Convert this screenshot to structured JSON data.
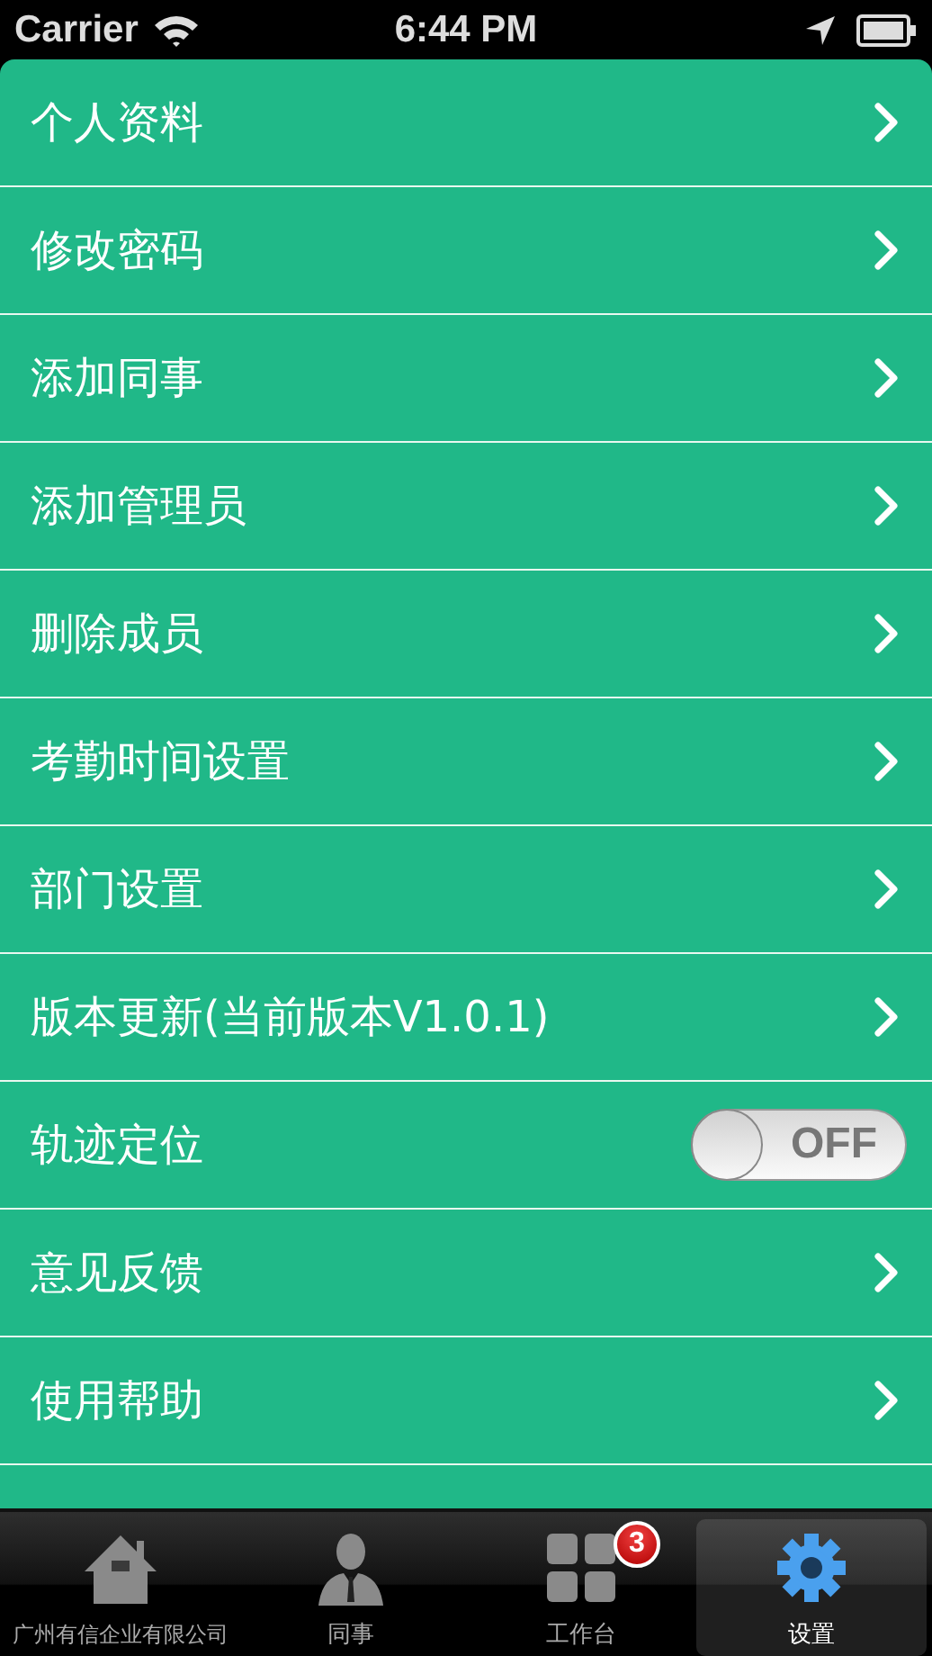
{
  "status_bar": {
    "carrier": "Carrier",
    "time": "6:44 PM"
  },
  "settings": [
    {
      "kind": "link",
      "label": "个人资料"
    },
    {
      "kind": "link",
      "label": "修改密码"
    },
    {
      "kind": "link",
      "label": "添加同事"
    },
    {
      "kind": "link",
      "label": "添加管理员"
    },
    {
      "kind": "link",
      "label": "删除成员"
    },
    {
      "kind": "link",
      "label": "考勤时间设置"
    },
    {
      "kind": "link",
      "label": "部门设置"
    },
    {
      "kind": "link",
      "label": "版本更新(当前版本V1.0.1)"
    },
    {
      "kind": "toggle",
      "label": "轨迹定位",
      "on": false,
      "toggle_text": "OFF"
    },
    {
      "kind": "link",
      "label": "意见反馈"
    },
    {
      "kind": "link",
      "label": "使用帮助"
    }
  ],
  "tab_bar": [
    {
      "kind": "house",
      "label": "广州有信企业有限公司",
      "selected": false
    },
    {
      "kind": "person",
      "label": "同事",
      "selected": false
    },
    {
      "kind": "grid",
      "label": "工作台",
      "selected": false,
      "badge": "3"
    },
    {
      "kind": "gear",
      "label": "设置",
      "selected": true
    }
  ]
}
